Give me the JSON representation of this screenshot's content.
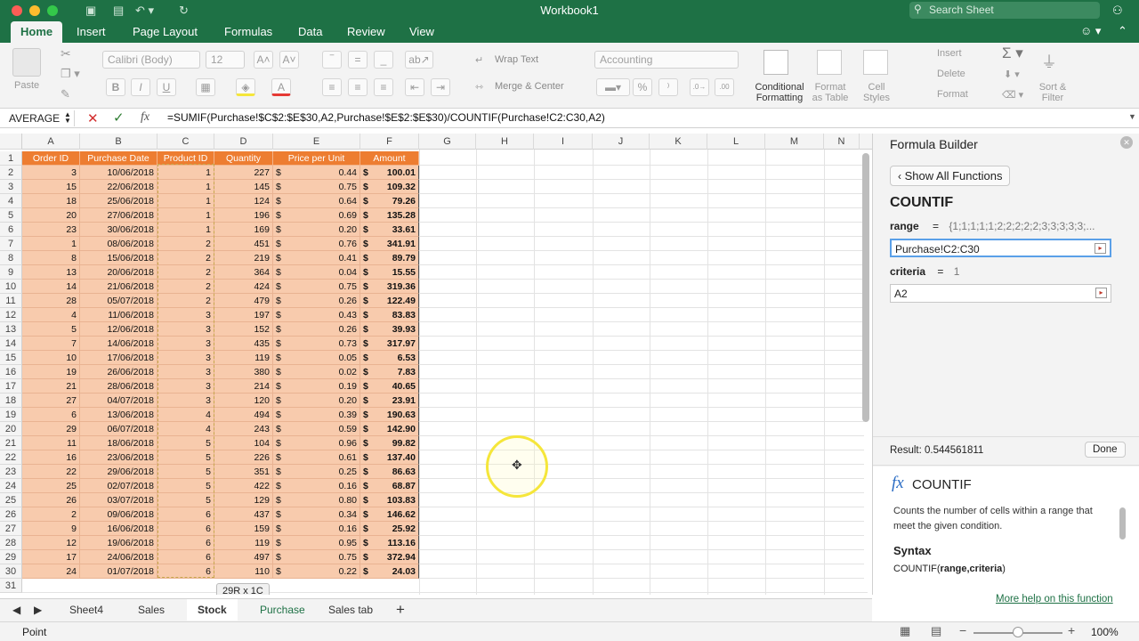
{
  "app": {
    "title": "Workbook1",
    "search_placeholder": "Search Sheet"
  },
  "ribbon_tabs": [
    "Home",
    "Insert",
    "Page Layout",
    "Formulas",
    "Data",
    "Review",
    "View"
  ],
  "ribbon": {
    "paste": "Paste",
    "font_name": "Calibri (Body)",
    "font_size": "12",
    "wrap_text": "Wrap Text",
    "merge_center": "Merge & Center",
    "number_format": "Accounting",
    "conditional_formatting": [
      "Conditional",
      "Formatting"
    ],
    "format_as_table": [
      "Format",
      "as Table"
    ],
    "cell_styles": [
      "Cell",
      "Styles"
    ],
    "insert": "Insert",
    "delete": "Delete",
    "format": "Format",
    "sort_filter": [
      "Sort &",
      "Filter"
    ]
  },
  "formula_bar": {
    "name_box": "AVERAGE",
    "formula": "=SUMIF(Purchase!$C$2:$E$30,A2,Purchase!$E$2:$E$30)/COUNTIF(Purchase!C2:C30,A2)"
  },
  "columns": [
    "A",
    "B",
    "C",
    "D",
    "E",
    "F",
    "G",
    "H",
    "I",
    "J",
    "K",
    "L",
    "M",
    "N"
  ],
  "table_headers": [
    "Order ID",
    "Purchase Date",
    "Product ID",
    "Quantity",
    "Price per Unit",
    "Amount"
  ],
  "rows": [
    [
      "3",
      "10/06/2018",
      "1",
      "227",
      "0.44",
      "100.01"
    ],
    [
      "15",
      "22/06/2018",
      "1",
      "145",
      "0.75",
      "109.32"
    ],
    [
      "18",
      "25/06/2018",
      "1",
      "124",
      "0.64",
      "79.26"
    ],
    [
      "20",
      "27/06/2018",
      "1",
      "196",
      "0.69",
      "135.28"
    ],
    [
      "23",
      "30/06/2018",
      "1",
      "169",
      "0.20",
      "33.61"
    ],
    [
      "1",
      "08/06/2018",
      "2",
      "451",
      "0.76",
      "341.91"
    ],
    [
      "8",
      "15/06/2018",
      "2",
      "219",
      "0.41",
      "89.79"
    ],
    [
      "13",
      "20/06/2018",
      "2",
      "364",
      "0.04",
      "15.55"
    ],
    [
      "14",
      "21/06/2018",
      "2",
      "424",
      "0.75",
      "319.36"
    ],
    [
      "28",
      "05/07/2018",
      "2",
      "479",
      "0.26",
      "122.49"
    ],
    [
      "4",
      "11/06/2018",
      "3",
      "197",
      "0.43",
      "83.83"
    ],
    [
      "5",
      "12/06/2018",
      "3",
      "152",
      "0.26",
      "39.93"
    ],
    [
      "7",
      "14/06/2018",
      "3",
      "435",
      "0.73",
      "317.97"
    ],
    [
      "10",
      "17/06/2018",
      "3",
      "119",
      "0.05",
      "6.53"
    ],
    [
      "19",
      "26/06/2018",
      "3",
      "380",
      "0.02",
      "7.83"
    ],
    [
      "21",
      "28/06/2018",
      "3",
      "214",
      "0.19",
      "40.65"
    ],
    [
      "27",
      "04/07/2018",
      "3",
      "120",
      "0.20",
      "23.91"
    ],
    [
      "6",
      "13/06/2018",
      "4",
      "494",
      "0.39",
      "190.63"
    ],
    [
      "29",
      "06/07/2018",
      "4",
      "243",
      "0.59",
      "142.90"
    ],
    [
      "11",
      "18/06/2018",
      "5",
      "104",
      "0.96",
      "99.82"
    ],
    [
      "16",
      "23/06/2018",
      "5",
      "226",
      "0.61",
      "137.40"
    ],
    [
      "22",
      "29/06/2018",
      "5",
      "351",
      "0.25",
      "86.63"
    ],
    [
      "25",
      "02/07/2018",
      "5",
      "422",
      "0.16",
      "68.87"
    ],
    [
      "26",
      "03/07/2018",
      "5",
      "129",
      "0.80",
      "103.83"
    ],
    [
      "2",
      "09/06/2018",
      "6",
      "437",
      "0.34",
      "146.62"
    ],
    [
      "9",
      "16/06/2018",
      "6",
      "159",
      "0.16",
      "25.92"
    ],
    [
      "12",
      "19/06/2018",
      "6",
      "119",
      "0.95",
      "113.16"
    ],
    [
      "17",
      "24/06/2018",
      "6",
      "497",
      "0.75",
      "372.94"
    ],
    [
      "24",
      "01/07/2018",
      "6",
      "110",
      "0.22",
      "24.03"
    ]
  ],
  "currency_symbol": "$",
  "selection_tip": "29R x 1C",
  "sheet_tabs": [
    "Sheet4",
    "Sales",
    "Stock",
    "Purchase",
    "Sales tab"
  ],
  "active_sheet": "Stock",
  "status": {
    "mode": "Point",
    "zoom": "100%"
  },
  "formula_builder": {
    "title": "Formula Builder",
    "show_all": "Show All Functions",
    "function_name": "COUNTIF",
    "range_label": "range",
    "range_preview": "{1;1;1;1;1;2;2;2;2;2;3;3;3;3;3;...",
    "range_value": "Purchase!C2:C30",
    "criteria_label": "criteria",
    "criteria_preview": "1",
    "criteria_value": "A2",
    "equals": "=",
    "result": "Result: 0.544561811",
    "done": "Done",
    "help_title": "COUNTIF",
    "help_desc": "Counts the number of cells within a range that meet the given condition.",
    "syntax_label": "Syntax",
    "syntax_fn": "COUNTIF(",
    "syntax_args": "range,criteria",
    "syntax_close": ")",
    "more_help": "More help on this function"
  },
  "colors": {
    "accent_green": "#1e7145",
    "header_orange": "#ed7d31",
    "data_peach": "#f8cbad"
  }
}
